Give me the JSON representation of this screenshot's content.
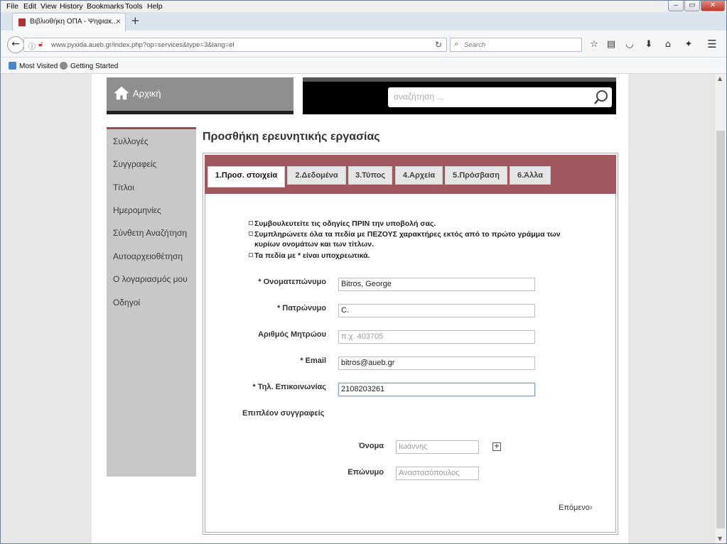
{
  "browser": {
    "menu": [
      "File",
      "Edit",
      "View",
      "History",
      "Bookmarks",
      "Tools",
      "Help"
    ],
    "tab_title": "Βιβλιοθήκη ΟΠΑ - Ψηφιακ...",
    "tab_close": "×",
    "new_tab": "+",
    "url": "www.pyxida.aueb.gr/index.php?op=services&type=3&lang=el",
    "search_placeholder": "Search",
    "bookmarks": [
      "Most Visited",
      "Getting Started"
    ],
    "win_controls": [
      "–",
      "▭",
      "✕"
    ]
  },
  "site": {
    "home_label": "Αρχική",
    "search_placeholder": "αναζήτηση ...",
    "sidebar": [
      "Συλλογές",
      "Συγγραφείς",
      "Τίτλοι",
      "Ημερομηνίες",
      "Σύνθετη Αναζήτηση",
      "Αυτοαρχειοθέτηση",
      "Ο λογαριασμός μου",
      "Οδηγοί"
    ]
  },
  "form": {
    "title": "Προσθήκη ερευνητικής εργασίας",
    "steps": [
      "1.Προσ. στοιχεία",
      "2.Δεδομένα",
      "3.Τύπος",
      "4.Αρχεία",
      "5.Πρόσβαση",
      "6.Άλλα"
    ],
    "active_step": 0,
    "notes": [
      "Συμβουλευτείτε τις οδηγίες ΠΡΙΝ την υποβολή σας.",
      "Συμπληρώνετε όλα τα πεδία με ΠΕΖΟΥΣ χαρακτήρες εκτός από το πρώτο γράμμα των κυρίων ονομάτων και των τίτλων.",
      "Τα πεδία με * είναι υποχρεωτικά."
    ],
    "fields": {
      "fullname": {
        "label": "* Ονοματεπώνυμο",
        "value": "Bitros, George"
      },
      "fathername": {
        "label": "* Πατρώνυμο",
        "value": "C."
      },
      "regnum": {
        "label": "Αριθμός Μητρώου",
        "placeholder": "π.χ. 403705"
      },
      "email": {
        "label": "* Email",
        "value": "bitros@aueb.gr"
      },
      "phone": {
        "label": "* Τηλ. Επικοινωνίας",
        "value": "2108203261"
      }
    },
    "coauthors": {
      "heading": "Επιπλέον συγγραφείς",
      "first_label": "Όνομα",
      "first_placeholder": "Ιωάννης",
      "last_label": "Επώνυμο",
      "last_placeholder": "Αναστασόπουλος",
      "add": "+"
    },
    "next": "Επόμενο"
  }
}
